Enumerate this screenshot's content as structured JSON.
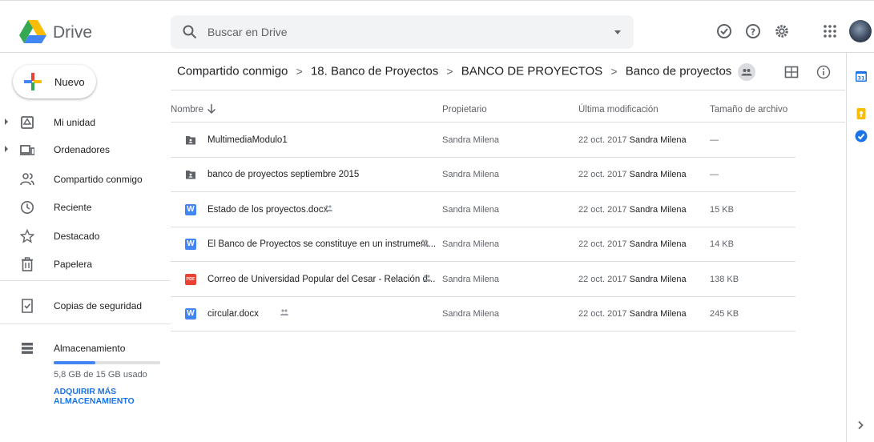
{
  "app": {
    "name": "Drive"
  },
  "search": {
    "placeholder": "Buscar en Drive"
  },
  "new_button": {
    "label": "Nuevo"
  },
  "sidebar": {
    "items": [
      {
        "label": "Mi unidad",
        "icon": "drive-icon",
        "expandable": true
      },
      {
        "label": "Ordenadores",
        "icon": "computers-icon",
        "expandable": true
      },
      {
        "label": "Compartido conmigo",
        "icon": "shared-with-me-icon"
      },
      {
        "label": "Reciente",
        "icon": "clock-icon"
      },
      {
        "label": "Destacado",
        "icon": "star-icon"
      },
      {
        "label": "Papelera",
        "icon": "trash-icon"
      },
      {
        "label": "Copias de seguridad",
        "icon": "backup-icon"
      },
      {
        "label": "Almacenamiento",
        "icon": "storage-icon"
      }
    ],
    "storage": {
      "used_text": "5,8 GB de 15 GB usado",
      "used_fraction": 0.39,
      "upgrade_link": "ADQUIRIR MÁS ALMACENAMIENTO"
    }
  },
  "breadcrumb": [
    "Compartido conmigo",
    "18. Banco de Proyectos",
    "BANCO DE PROYECTOS",
    "Banco de proyectos"
  ],
  "breadcrumb_separator": ">",
  "table": {
    "columns": [
      "Nombre",
      "Propietario",
      "Última modificación",
      "Tamaño de archivo"
    ],
    "rows": [
      {
        "name": "MultimediaModulo1",
        "type": "shared-folder",
        "shared": false,
        "owner": "Sandra Milena",
        "modified_date": "22 oct. 2017",
        "modified_by": "Sandra Milena",
        "size": "—"
      },
      {
        "name": "banco de proyectos septiembre 2015",
        "type": "shared-folder",
        "shared": false,
        "owner": "Sandra Milena",
        "modified_date": "22 oct. 2017",
        "modified_by": "Sandra Milena",
        "size": "—"
      },
      {
        "name": "Estado de los proyectos.docx",
        "type": "word",
        "shared": true,
        "owner": "Sandra Milena",
        "modified_date": "22 oct. 2017",
        "modified_by": "Sandra Milena",
        "size": "15 KB"
      },
      {
        "name": "El Banco de Proyectos se constituye en un instrument...",
        "type": "word",
        "shared": true,
        "owner": "Sandra Milena",
        "modified_date": "22 oct. 2017",
        "modified_by": "Sandra Milena",
        "size": "14 KB"
      },
      {
        "name": "Correo de Universidad Popular del Cesar - Relación d...",
        "type": "pdf",
        "shared": true,
        "owner": "Sandra Milena",
        "modified_date": "22 oct. 2017",
        "modified_by": "Sandra Milena",
        "size": "138 KB"
      },
      {
        "name": "circular.docx",
        "type": "word",
        "shared": true,
        "owner": "Sandra Milena",
        "modified_date": "22 oct. 2017",
        "modified_by": "Sandra Milena",
        "size": "245 KB"
      }
    ]
  },
  "file_icon_labels": {
    "word": "W",
    "pdf": "PDF"
  },
  "colors": {
    "accent": "#1a73e8",
    "word": "#4285f4",
    "pdf": "#ea4335",
    "folder": "#5f6368",
    "calendar": "#1a73e8",
    "keep": "#fbbc04",
    "tasks": "#1a73e8"
  },
  "right_panel": {
    "calendar_day": "31",
    "icons": [
      "calendar-icon",
      "keep-icon",
      "tasks-icon"
    ]
  },
  "top_icons": [
    "offline-status-icon",
    "help-icon",
    "settings-icon",
    "apps-icon",
    "avatar"
  ]
}
